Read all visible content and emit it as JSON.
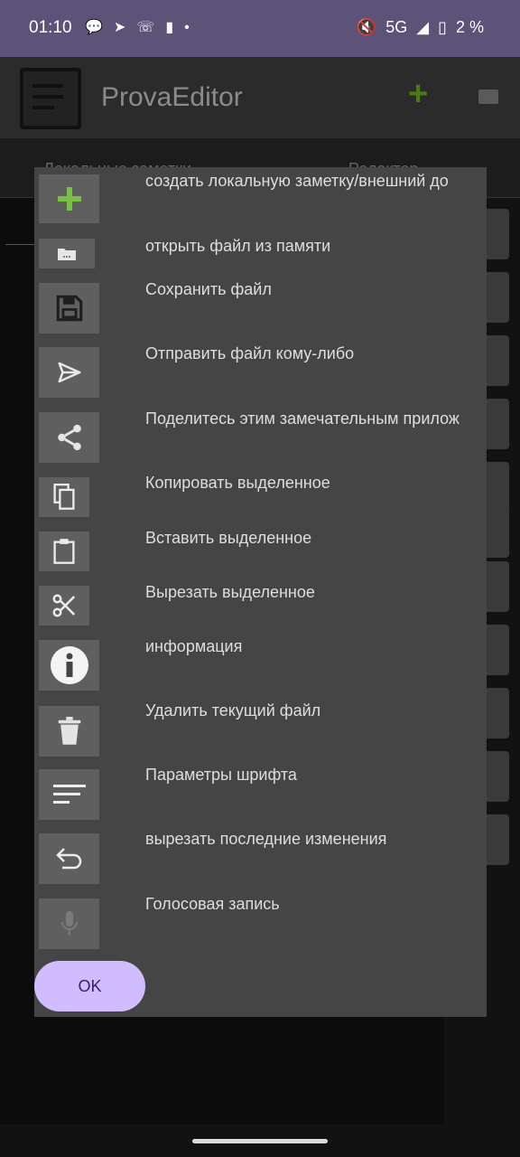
{
  "status_bar": {
    "time": "01:10",
    "network": "5G",
    "battery": "2 %"
  },
  "app": {
    "title": "ProvaEditor",
    "tabs": [
      "Локальные заметки",
      "Редактор"
    ]
  },
  "dialog": {
    "items": [
      {
        "label": "создать локальную заметку/внешний до",
        "icon": "plus-icon"
      },
      {
        "label": "открыть файл из памяти",
        "icon": "folder-icon"
      },
      {
        "label": "Сохранить файл",
        "icon": "save-icon"
      },
      {
        "label": "Отправить файл кому-либо",
        "icon": "send-icon"
      },
      {
        "label": "Поделитесь этим замечательным прилож",
        "icon": "share-icon"
      },
      {
        "label": "Копировать выделенное",
        "icon": "copy-icon"
      },
      {
        "label": "Вставить выделенное",
        "icon": "paste-icon"
      },
      {
        "label": "Вырезать выделенное",
        "icon": "scissors-icon"
      },
      {
        "label": "информация",
        "icon": "info-icon"
      },
      {
        "label": "Удалить текущий файл",
        "icon": "trash-icon"
      },
      {
        "label": "Параметры шрифта",
        "icon": "font-settings-icon"
      },
      {
        "label": "вырезать последние изменения",
        "icon": "undo-icon"
      },
      {
        "label": "Голосовая запись",
        "icon": "mic-icon"
      }
    ],
    "ok_label": "OK"
  },
  "colors": {
    "status_bar": "#5d5277",
    "dialog_bg": "#454545",
    "button_bg": "#5f5f5f",
    "accent_green": "#76c043",
    "ok_button": "#d0bcff"
  }
}
